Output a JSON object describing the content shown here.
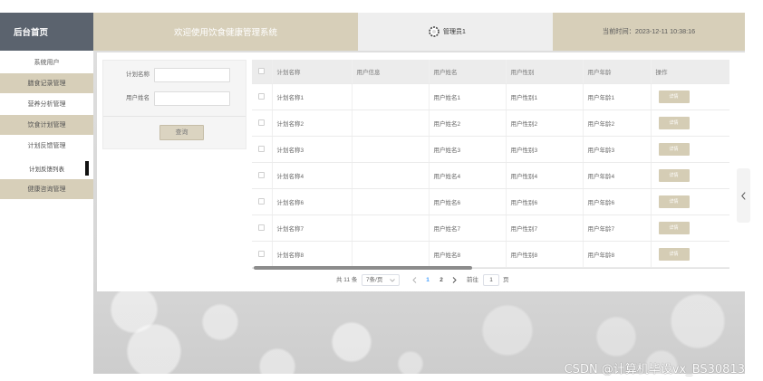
{
  "colors": {
    "brand_bg": "#5b636e",
    "beige_accent": "#d7cfb9",
    "header_gray": "#eeeeee",
    "active_page": "#409eff",
    "detail_button": "#d5cdb5"
  },
  "icons": {
    "avatar": "avatar-icon",
    "page_size_dropdown": "chevron-down-icon",
    "prev_page": "chevron-left-icon",
    "next_page": "chevron-right-icon",
    "side_toggle": "chevron-left-icon"
  },
  "header": {
    "brand": "后台首页",
    "welcome": "欢迎使用饮食健康管理系统",
    "user_name": "管理员1",
    "current_time": "当前时间：2023-12-11 10:38:16"
  },
  "sidebar": {
    "items": [
      {
        "label": "系统用户",
        "active": false
      },
      {
        "label": "膳食记录管理",
        "active": false
      },
      {
        "label": "营养分析管理",
        "active": false
      },
      {
        "label": "饮食计划管理",
        "active": false
      },
      {
        "label": "计划反馈管理",
        "active": false
      },
      {
        "label": "计划反馈列表",
        "active": true
      },
      {
        "label": "健康咨询管理",
        "active": false
      }
    ]
  },
  "search": {
    "plan_name": {
      "label": "计划名称",
      "value": ""
    },
    "user_name": {
      "label": "用户姓名",
      "value": ""
    },
    "submit_label": "查询"
  },
  "table": {
    "columns": [
      "计划名称",
      "用户信息",
      "用户姓名",
      "用户性别",
      "用户年龄",
      "操作"
    ],
    "rows": [
      {
        "plan_name": "计划名称1",
        "user_info": "",
        "user_name": "用户姓名1",
        "user_gender": "用户性别1",
        "user_age": "用户年龄1",
        "action": "详情"
      },
      {
        "plan_name": "计划名称2",
        "user_info": "",
        "user_name": "用户姓名2",
        "user_gender": "用户性别2",
        "user_age": "用户年龄2",
        "action": "详情"
      },
      {
        "plan_name": "计划名称3",
        "user_info": "",
        "user_name": "用户姓名3",
        "user_gender": "用户性别3",
        "user_age": "用户年龄3",
        "action": "详情"
      },
      {
        "plan_name": "计划名称4",
        "user_info": "",
        "user_name": "用户姓名4",
        "user_gender": "用户性别4",
        "user_age": "用户年龄4",
        "action": "详情"
      },
      {
        "plan_name": "计划名称6",
        "user_info": "",
        "user_name": "用户姓名6",
        "user_gender": "用户性别6",
        "user_age": "用户年龄6",
        "action": "详情"
      },
      {
        "plan_name": "计划名称7",
        "user_info": "",
        "user_name": "用户姓名7",
        "user_gender": "用户性别7",
        "user_age": "用户年龄7",
        "action": "详情"
      },
      {
        "plan_name": "计划名称8",
        "user_info": "",
        "user_name": "用户姓名8",
        "user_gender": "用户性别8",
        "user_age": "用户年龄8",
        "action": "详情"
      }
    ],
    "horizontal_scroll": {
      "thumb_percent": 46,
      "position_percent": 0
    }
  },
  "pagination": {
    "total": "共 11 条",
    "page_size": "7条/页",
    "pages": [
      {
        "label": "1",
        "active": true
      },
      {
        "label": "2",
        "active": false
      }
    ],
    "goto_label": "前往",
    "goto_value": "1",
    "page_suffix": "页"
  },
  "watermark": "CSDN @计算机毕设vx_BS30813"
}
